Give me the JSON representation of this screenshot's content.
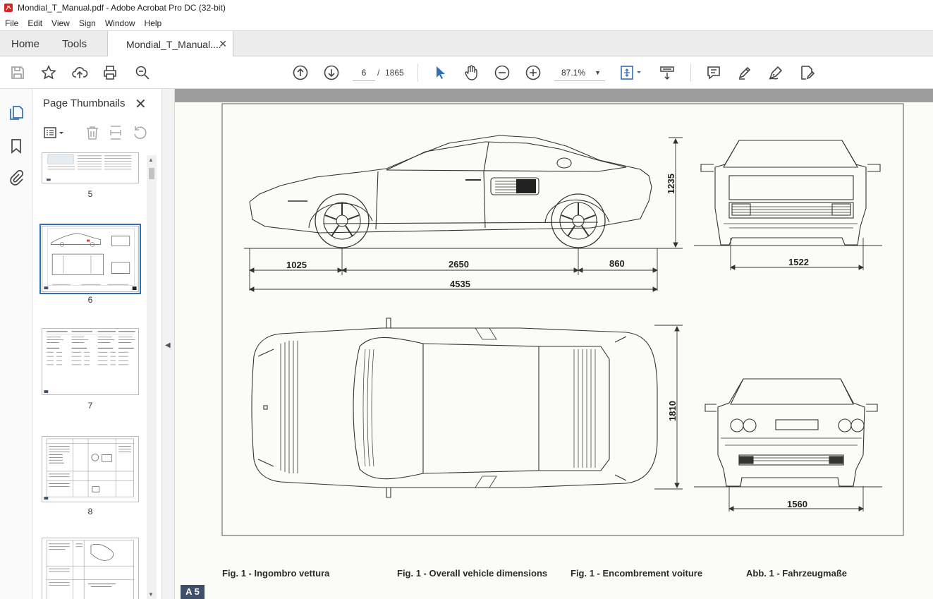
{
  "window": {
    "title": "Mondial_T_Manual.pdf - Adobe Acrobat Pro DC (32-bit)"
  },
  "menu": [
    "File",
    "Edit",
    "View",
    "Sign",
    "Window",
    "Help"
  ],
  "tabs": {
    "home": "Home",
    "tools": "Tools",
    "document": "Mondial_T_Manual....",
    "close_symbol": "✕"
  },
  "toolbar": {
    "current_page": "6",
    "page_separator": "/",
    "total_pages": "1865",
    "zoom": "87.1%"
  },
  "thumbnails": {
    "title": "Page Thumbnails",
    "close_symbol": "✕",
    "pages": [
      {
        "number": "5",
        "selected": false
      },
      {
        "number": "6",
        "selected": true
      },
      {
        "number": "7",
        "selected": false
      },
      {
        "number": "8",
        "selected": false
      },
      {
        "number": "",
        "selected": false
      }
    ]
  },
  "document": {
    "dimensions": {
      "height": "1235",
      "front_overhang": "1025",
      "wheelbase": "2650",
      "rear_overhang": "860",
      "length": "4535",
      "front_track": "1522",
      "width": "1810",
      "rear_track": "1560"
    },
    "captions": {
      "italian": "Fig. 1 - Ingombro vettura",
      "english": "Fig. 1 - Overall vehicle dimensions",
      "french": "Fig. 1 - Encombrement voiture",
      "german": "Abb. 1 - Fahrzeugmaße"
    },
    "page_label": "A 5"
  },
  "colors": {
    "accent": "#2f6fb8",
    "pdf_red": "#d8261f",
    "doc_background": "#9d9d9d",
    "page_label_bg": "#3f4f6a"
  }
}
